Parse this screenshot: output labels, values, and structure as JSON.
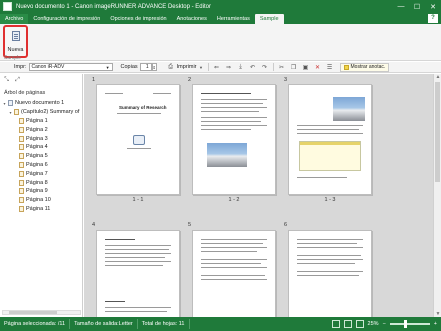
{
  "titlebar": {
    "title": "Nuevo documento 1 - Canon imageRUNNER ADVANCE Desktop - Editor",
    "minimize": "—",
    "maximize": "☐",
    "close": "✕"
  },
  "ribbon_tabs": [
    {
      "label": "Archivo"
    },
    {
      "label": "Configuración de impresión"
    },
    {
      "label": "Opciones de impresión"
    },
    {
      "label": "Anotaciones"
    },
    {
      "label": "Herramientas"
    },
    {
      "label": "Sample"
    }
  ],
  "help_label": "?",
  "ribbon": {
    "nueva_label": "Nueva",
    "group_label": "Sample"
  },
  "toolbar": {
    "printer_label": "Impr:",
    "printer_value": "Canon iR-ADV",
    "copies_label": "Copias",
    "copies_value": "1",
    "print_label": "Imprimir",
    "show_annotations_label": "Mostrar anotac."
  },
  "left_panel": {
    "tree_heading": "Árbol de páginas",
    "tree": [
      {
        "label": "Nuevo documento 1",
        "level": 1,
        "type": "root"
      },
      {
        "label": "(Capítulo2) Summary of",
        "level": 2,
        "type": "chapter"
      },
      {
        "label": "Página 1",
        "level": 3,
        "type": "page"
      },
      {
        "label": "Página 2",
        "level": 3,
        "type": "page"
      },
      {
        "label": "Página 3",
        "level": 3,
        "type": "page"
      },
      {
        "label": "Página 4",
        "level": 3,
        "type": "page"
      },
      {
        "label": "Página 5",
        "level": 3,
        "type": "page"
      },
      {
        "label": "Página 6",
        "level": 3,
        "type": "page"
      },
      {
        "label": "Página 7",
        "level": 3,
        "type": "page"
      },
      {
        "label": "Página 8",
        "level": 3,
        "type": "page"
      },
      {
        "label": "Página 9",
        "level": 3,
        "type": "page"
      },
      {
        "label": "Página 10",
        "level": 3,
        "type": "page"
      },
      {
        "label": "Página 11",
        "level": 3,
        "type": "page"
      }
    ]
  },
  "pages": [
    {
      "number": "1",
      "label": "1 - 1",
      "title": "Summary of Research"
    },
    {
      "number": "2",
      "label": "1 - 2"
    },
    {
      "number": "3",
      "label": "1 - 3"
    },
    {
      "number": "4"
    },
    {
      "number": "5"
    },
    {
      "number": "6"
    }
  ],
  "statusbar": {
    "selected": "Página seleccionada: /11",
    "output_size": "Tamaño de salida:Letter",
    "total": "Total de hojas: 11",
    "zoom": "25%"
  },
  "colors": {
    "brand_green": "#1f7a3a",
    "highlight_red": "#e03030"
  }
}
